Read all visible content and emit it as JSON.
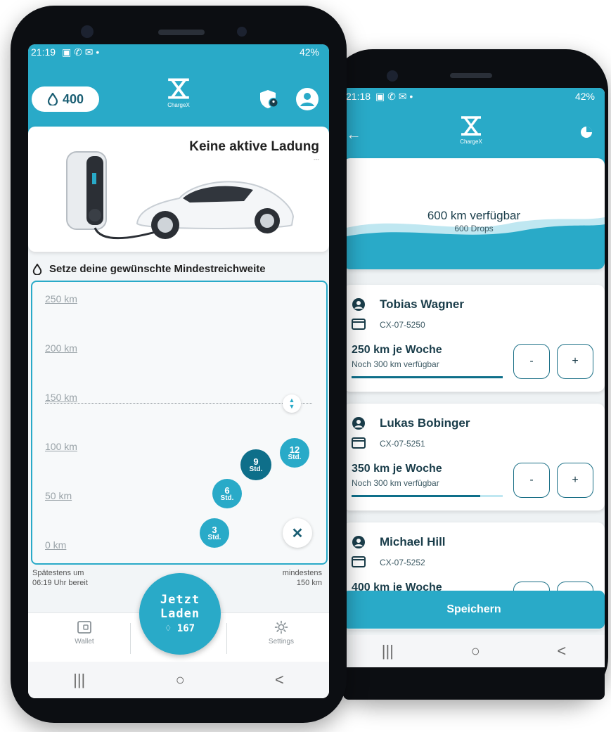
{
  "left_phone": {
    "status_time": "21:19",
    "status_battery": "42%",
    "drops_balance": "400",
    "logo_text": "ChargeX",
    "charge_card": {
      "title": "Keine aktive Ladung",
      "subtitle": "---"
    },
    "range_title": "Setze deine gewünschte Mindestreichweite",
    "range_axis": [
      "250 km",
      "200 km",
      "150 km",
      "100 km",
      "50 km",
      "0 km"
    ],
    "time_bubbles": [
      {
        "num": "3",
        "unit": "Std."
      },
      {
        "num": "6",
        "unit": "Std."
      },
      {
        "num": "9",
        "unit": "Std."
      },
      {
        "num": "12",
        "unit": "Std."
      }
    ],
    "ready_text_line1": "Spätestens um",
    "ready_text_line2": "06:19 Uhr bereit",
    "min_text_line1": "mindestens",
    "min_text_line2": "150 km",
    "charge_button": {
      "line1": "Jetzt",
      "line2": "Laden",
      "cost": "167"
    },
    "tabs": {
      "wallet": "Wallet",
      "settings": "Settings"
    },
    "nav": {
      "recent": "|||",
      "home": "○",
      "back": "<"
    }
  },
  "right_phone": {
    "status_time": "21:18",
    "status_battery": "42%",
    "logo_text": "ChargeX",
    "available": {
      "km": "600 km verfügbar",
      "drops": "600 Drops"
    },
    "users": [
      {
        "name": "Tobias Wagner",
        "card_id": "CX-07-5250",
        "weekly": "250 km je Woche",
        "remaining": "Noch 300 km verfügbar",
        "progress": 1.0
      },
      {
        "name": "Lukas Bobinger",
        "card_id": "CX-07-5251",
        "weekly": "350 km je Woche",
        "remaining": "Noch 300 km verfügbar",
        "progress": 0.85
      },
      {
        "name": "Michael Hill",
        "card_id": "CX-07-5252",
        "weekly": "400 km je Woche",
        "remaining": "",
        "progress": 0
      }
    ],
    "minus_label": "-",
    "plus_label": "+",
    "save_button": "Speichern",
    "nav": {
      "recent": "|||",
      "home": "○",
      "back": "<"
    }
  },
  "colors": {
    "accent": "#29aac8",
    "dark_accent": "#0e6f8a",
    "text_dark": "#1a3d4a"
  }
}
